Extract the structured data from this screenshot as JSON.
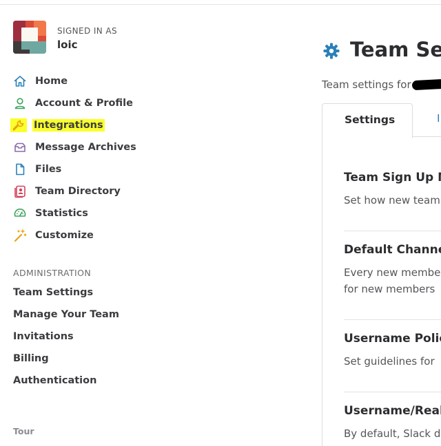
{
  "user": {
    "signed_in_label": "SIGNED IN AS",
    "name": "loic"
  },
  "nav": {
    "items": [
      {
        "label": "Home",
        "icon": "home-icon"
      },
      {
        "label": "Account & Profile",
        "icon": "person-icon"
      },
      {
        "label": "Integrations",
        "icon": "wrench-icon",
        "highlighted": true
      },
      {
        "label": "Message Archives",
        "icon": "inbox-icon"
      },
      {
        "label": "Files",
        "icon": "file-icon"
      },
      {
        "label": "Team Directory",
        "icon": "directory-icon"
      },
      {
        "label": "Statistics",
        "icon": "dashboard-icon"
      },
      {
        "label": "Customize",
        "icon": "magic-wand-icon"
      }
    ]
  },
  "admin": {
    "heading": "ADMINISTRATION",
    "items": [
      "Team Settings",
      "Manage Your Team",
      "Invitations",
      "Billing",
      "Authentication"
    ]
  },
  "footer": {
    "tour": "Tour"
  },
  "main": {
    "title": "Team Sett",
    "subtitle": "Team settings for",
    "tabs": [
      "Settings",
      "I"
    ],
    "sections": [
      {
        "title": "Team Sign Up M",
        "desc": [
          "Set how new team"
        ]
      },
      {
        "title": "Default Channe",
        "desc": [
          "Every new membe",
          "for new members"
        ]
      },
      {
        "title": "Username Polic",
        "desc": [
          "Set guidelines for"
        ]
      },
      {
        "title": "Username/Real",
        "desc": [
          "By default, Slack d"
        ]
      }
    ]
  },
  "colors": {
    "highlight": "#fbff2a",
    "gear": "#2a80b9",
    "link": "#2a80b9"
  }
}
